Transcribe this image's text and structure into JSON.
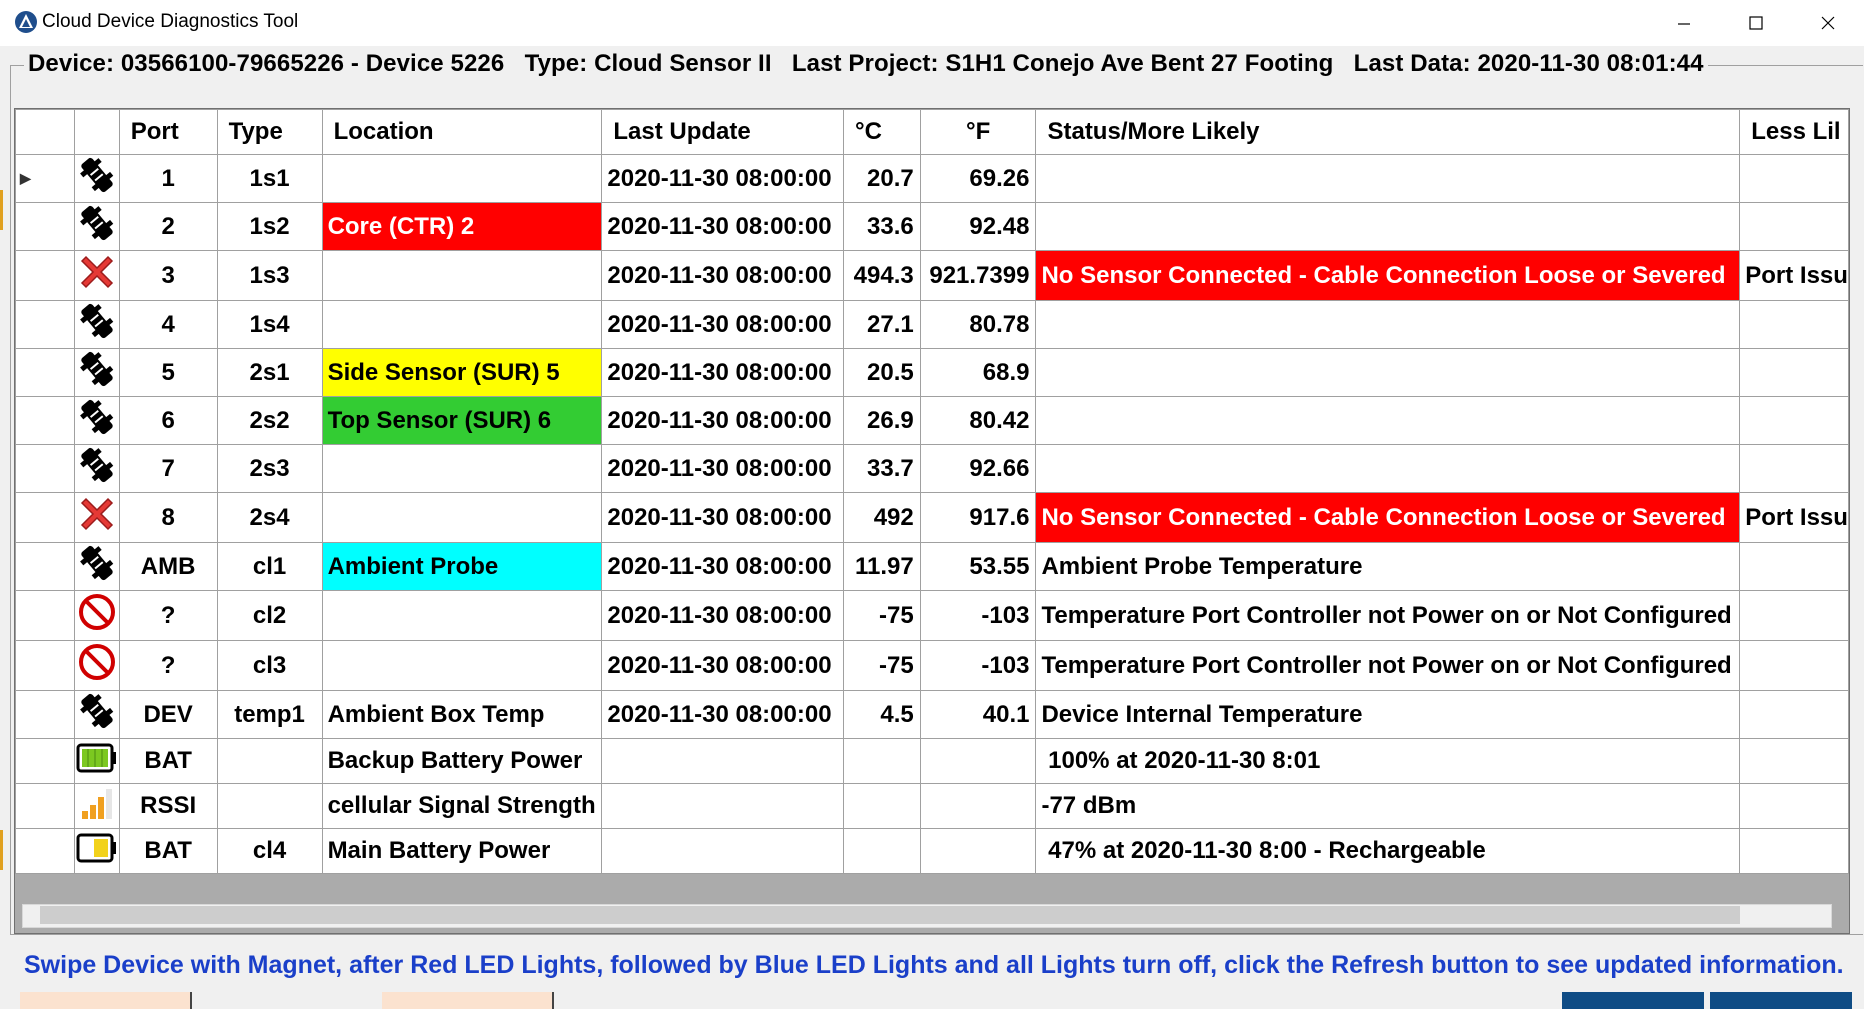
{
  "window": {
    "title": "Cloud Device Diagnostics Tool",
    "icons": {
      "app": "cloud-app-icon",
      "minimize": "minimize-icon",
      "maximize": "maximize-icon",
      "close": "close-icon"
    }
  },
  "header": {
    "text": "Device: 03566100-79665226 - Device 5226   Type: Cloud Sensor II   Last Project: S1H1 Conejo Ave Bent 27 Footing   Last Data: 2020-11-30 08:01:44"
  },
  "colors": {
    "red": "#ff0000",
    "yellow": "#ffff00",
    "green": "#33cc33",
    "cyan": "#00ffff",
    "notice_blue": "#1a3fc9"
  },
  "grid": {
    "columns": [
      "",
      "",
      "Port",
      "Type",
      "Location",
      "Last Update",
      "°C",
      "°F",
      "Status/More Likely",
      "Less Lil"
    ],
    "rows": [
      {
        "icon": "plug-icon",
        "port": "1",
        "type": "1s1",
        "location": "",
        "loc_color": "",
        "last_update": "2020-11-30 08:00:00",
        "c": "20.7",
        "f": "69.26",
        "status": "",
        "status_color": "",
        "less": "",
        "selected": true
      },
      {
        "icon": "plug-icon",
        "port": "2",
        "type": "1s2",
        "location": "Core (CTR) 2",
        "loc_color": "red",
        "last_update": "2020-11-30 08:00:00",
        "c": "33.6",
        "f": "92.48",
        "status": "",
        "status_color": "",
        "less": ""
      },
      {
        "icon": "error-x-icon",
        "port": "3",
        "type": "1s3",
        "location": "",
        "loc_color": "",
        "last_update": "2020-11-30 08:00:00",
        "c": "494.3",
        "f": "921.7399",
        "status": "No Sensor Connected - Cable Connection Loose or Severed",
        "status_color": "red",
        "less": "Port Issu"
      },
      {
        "icon": "plug-icon",
        "port": "4",
        "type": "1s4",
        "location": "",
        "loc_color": "",
        "last_update": "2020-11-30 08:00:00",
        "c": "27.1",
        "f": "80.78",
        "status": "",
        "status_color": "",
        "less": ""
      },
      {
        "icon": "plug-icon",
        "port": "5",
        "type": "2s1",
        "location": "Side Sensor (SUR) 5",
        "loc_color": "yellow",
        "last_update": "2020-11-30 08:00:00",
        "c": "20.5",
        "f": "68.9",
        "status": "",
        "status_color": "",
        "less": ""
      },
      {
        "icon": "plug-icon",
        "port": "6",
        "type": "2s2",
        "location": "Top Sensor (SUR) 6",
        "loc_color": "green",
        "last_update": "2020-11-30 08:00:00",
        "c": "26.9",
        "f": "80.42",
        "status": "",
        "status_color": "",
        "less": ""
      },
      {
        "icon": "plug-icon",
        "port": "7",
        "type": "2s3",
        "location": "",
        "loc_color": "",
        "last_update": "2020-11-30 08:00:00",
        "c": "33.7",
        "f": "92.66",
        "status": "",
        "status_color": "",
        "less": ""
      },
      {
        "icon": "error-x-icon",
        "port": "8",
        "type": "2s4",
        "location": "",
        "loc_color": "",
        "last_update": "2020-11-30 08:00:00",
        "c": "492",
        "f": "917.6",
        "status": "No Sensor Connected - Cable Connection Loose or Severed",
        "status_color": "red",
        "less": "Port Issu"
      },
      {
        "icon": "plug-icon",
        "port": "AMB",
        "type": "cl1",
        "location": "Ambient Probe",
        "loc_color": "cyan",
        "last_update": "2020-11-30 08:00:00",
        "c": "11.97",
        "f": "53.55",
        "status": "Ambient Probe Temperature",
        "status_color": "",
        "less": ""
      },
      {
        "icon": "prohibited-icon",
        "port": "?",
        "type": "cl2",
        "location": "",
        "loc_color": "",
        "last_update": "2020-11-30 08:00:00",
        "c": "-75",
        "f": "-103",
        "status": "Temperature Port Controller not Power on or Not Configured",
        "status_color": "",
        "less": ""
      },
      {
        "icon": "prohibited-icon",
        "port": "?",
        "type": "cl3",
        "location": "",
        "loc_color": "",
        "last_update": "2020-11-30 08:00:00",
        "c": "-75",
        "f": "-103",
        "status": "Temperature Port Controller not Power on or Not Configured",
        "status_color": "",
        "less": ""
      },
      {
        "icon": "plug-icon",
        "port": "DEV",
        "type": "temp1",
        "location": "Ambient Box Temp",
        "loc_color": "",
        "last_update": "2020-11-30 08:00:00",
        "c": "4.5",
        "f": "40.1",
        "status": "Device Internal Temperature",
        "status_color": "",
        "less": ""
      },
      {
        "icon": "battery-full-icon",
        "port": "BAT",
        "type": "",
        "location": "Backup Battery Power",
        "loc_color": "",
        "last_update": "",
        "c": "",
        "f": "",
        "status": " 100% at 2020-11-30 8:01",
        "status_color": "",
        "less": ""
      },
      {
        "icon": "signal-bars-icon",
        "port": "RSSI",
        "type": "",
        "location": "cellular Signal Strength",
        "loc_color": "",
        "last_update": "",
        "c": "",
        "f": "",
        "status": "-77 dBm",
        "status_color": "",
        "less": ""
      },
      {
        "icon": "battery-half-icon",
        "port": "BAT",
        "type": "cl4",
        "location": "Main Battery Power",
        "loc_color": "",
        "last_update": "",
        "c": "",
        "f": "",
        "status": " 47% at 2020-11-30 8:00 - Rechargeable",
        "status_color": "",
        "less": ""
      }
    ],
    "battery_levels": {
      "backup_percent": 100,
      "main_percent": 47
    }
  },
  "notice": "Swipe Device with  Magnet, after Red LED Lights, followed by Blue LED Lights and all Lights turn off, click the Refresh button to see updated information."
}
